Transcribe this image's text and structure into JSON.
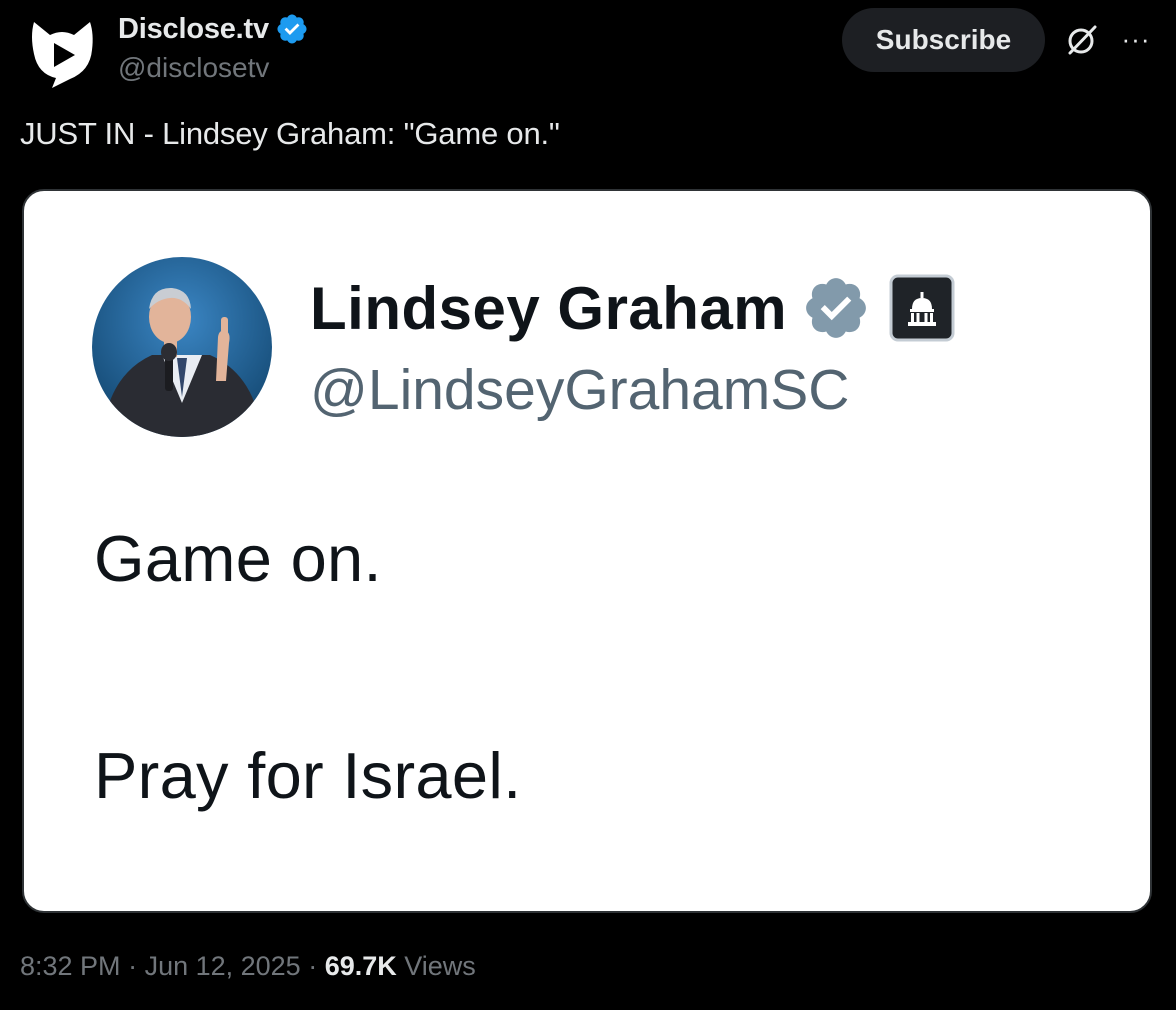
{
  "author": {
    "name": "Disclose.tv",
    "handle": "@disclosetv",
    "avatar_icon": "disclosetv-logo-icon",
    "verified_icon": "verified-badge-icon",
    "verified_color": "#1d9bf0"
  },
  "header": {
    "subscribe_label": "Subscribe",
    "grok_icon": "grok-icon",
    "more_icon": "more-options-icon",
    "more_glyph": "···"
  },
  "post": {
    "text": "JUST IN - Lindsey Graham: \"Game on.\""
  },
  "embedded_screenshot": {
    "name": "Lindsey Graham",
    "handle": "@LindseyGrahamSC",
    "verified_icon": "gray-verified-badge-icon",
    "verified_color": "#829aab",
    "affiliation_icon": "government-capitol-badge-icon",
    "line1": "Game on.",
    "line2": "Pray for Israel."
  },
  "meta": {
    "time": "8:32 PM",
    "separator": " · ",
    "date": "Jun 12, 2025",
    "views_count": "69.7K",
    "views_label": " Views"
  },
  "colors": {
    "background": "#000000",
    "primary_text": "#e7e9ea",
    "secondary_text": "#71767b",
    "subscribe_bg": "#1d1f23"
  }
}
